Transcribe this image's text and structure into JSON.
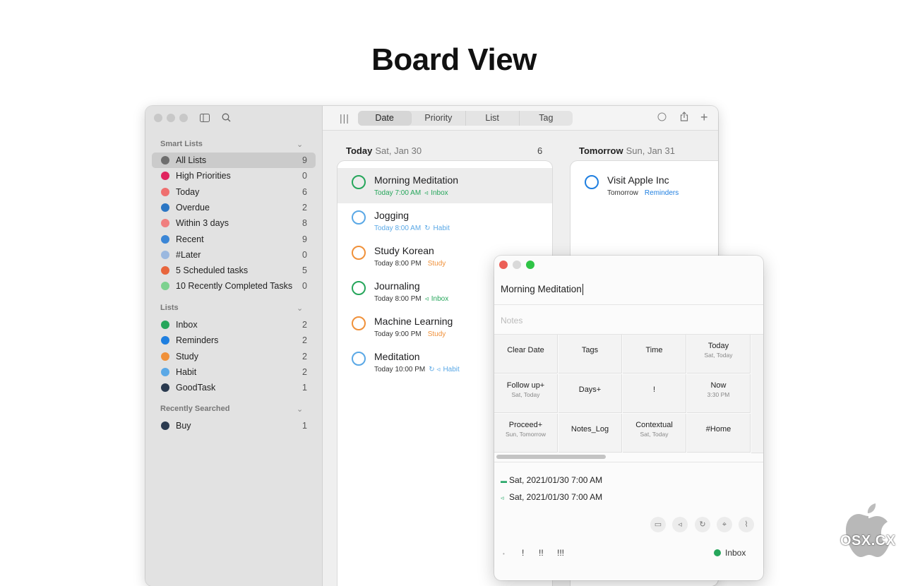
{
  "hero_title": "Board View",
  "sidebar": {
    "smart_header": "Smart Lists",
    "smart": [
      {
        "label": "All Lists",
        "count": "9",
        "icon": "checkmark-circle-icon",
        "color": "#6e6e6e",
        "selected": true
      },
      {
        "label": "High Priorities",
        "count": "0",
        "icon": "exclamation-icon",
        "color": "#e0245e"
      },
      {
        "label": "Today",
        "count": "6",
        "icon": "star-icon",
        "color": "#ef6f6f"
      },
      {
        "label": "Overdue",
        "count": "2",
        "icon": "overdue-icon",
        "color": "#2b76c4"
      },
      {
        "label": "Within 3 days",
        "count": "8",
        "icon": "clock-icon",
        "color": "#f07f7f"
      },
      {
        "label": "Recent",
        "count": "9",
        "icon": "plus-icon",
        "color": "#3b86d6"
      },
      {
        "label": "#Later",
        "count": "0",
        "icon": "hash-icon",
        "color": "#9bb8df"
      },
      {
        "label": "5 Scheduled tasks",
        "count": "5",
        "icon": "star-icon",
        "color": "#e8663d"
      },
      {
        "label": "10 Recently Completed Tasks",
        "count": "0",
        "icon": "check-icon",
        "color": "#7dd18f"
      }
    ],
    "lists_header": "Lists",
    "lists": [
      {
        "label": "Inbox",
        "count": "2",
        "icon": "inbox-icon",
        "color": "#26a65b"
      },
      {
        "label": "Reminders",
        "count": "2",
        "icon": "dot-icon",
        "color": "#1f7fe0"
      },
      {
        "label": "Study",
        "count": "2",
        "icon": "book-icon",
        "color": "#f0913a"
      },
      {
        "label": "Habit",
        "count": "2",
        "icon": "heart-icon",
        "color": "#5aa8e6"
      },
      {
        "label": "GoodTask",
        "count": "1",
        "icon": "check-icon",
        "color": "#2a3a4f"
      }
    ],
    "searched_header": "Recently Searched",
    "searched": [
      {
        "label": "Buy",
        "count": "1",
        "icon": "search-icon",
        "color": "#2a3a4f"
      }
    ]
  },
  "toolbar": {
    "tabs": [
      "Date",
      "Priority",
      "List",
      "Tag"
    ],
    "active": "Date"
  },
  "columns": {
    "today": {
      "title": "Today",
      "date": "Sat, Jan 30",
      "count": "6",
      "tasks": [
        {
          "title": "Morning Meditation",
          "time": "Today 7:00 AM",
          "list": "Inbox",
          "ring": "#26a65b",
          "time_color": "#26a65b",
          "list_color": "#26a65b",
          "list_icon": "◃"
        },
        {
          "title": "Jogging",
          "time": "Today 8:00 AM",
          "list": "Habit",
          "ring": "#5aa8e6",
          "time_color": "#5aa8e6",
          "list_color": "#5aa8e6",
          "list_icon": "↻"
        },
        {
          "title": "Study Korean",
          "time": "Today 8:00 PM",
          "list": "Study",
          "ring": "#f0913a",
          "time_color": "#333",
          "list_color": "#f0913a",
          "list_icon": ""
        },
        {
          "title": "Journaling",
          "time": "Today 8:00 PM",
          "list": "Inbox",
          "ring": "#26a65b",
          "time_color": "#333",
          "list_color": "#26a65b",
          "list_icon": "◃"
        },
        {
          "title": "Machine Learning",
          "time": "Today 9:00 PM",
          "list": "Study",
          "ring": "#f0913a",
          "time_color": "#333",
          "list_color": "#f0913a",
          "list_icon": ""
        },
        {
          "title": "Meditation",
          "time": "Today 10:00 PM",
          "list": "Habit",
          "ring": "#5aa8e6",
          "time_color": "#333",
          "list_color": "#5aa8e6",
          "list_icon": "↻ ◃"
        }
      ]
    },
    "tomorrow": {
      "title": "Tomorrow",
      "date": "Sun, Jan 31",
      "tasks": [
        {
          "title": "Visit Apple Inc",
          "time": "Tomorrow",
          "list": "Reminders",
          "ring": "#1f7fe0",
          "time_color": "#333",
          "list_color": "#1f7fe0",
          "list_icon": ""
        }
      ]
    }
  },
  "popup": {
    "title": "Morning Meditation",
    "notes_placeholder": "Notes",
    "grid": [
      {
        "main": "Clear Date",
        "sub": ""
      },
      {
        "main": "Tags",
        "sub": ""
      },
      {
        "main": "Time",
        "sub": ""
      },
      {
        "main": "Today",
        "sub": "Sat, Today"
      },
      {
        "main": "Follow up+",
        "sub": "Sat, Today"
      },
      {
        "main": "Days+",
        "sub": ""
      },
      {
        "main": "!",
        "sub": ""
      },
      {
        "main": "Now",
        "sub": "3:30 PM"
      },
      {
        "main": "Proceed+",
        "sub": "Sun, Tomorrow"
      },
      {
        "main": "Notes_Log",
        "sub": ""
      },
      {
        "main": "Contextual",
        "sub": "Sat, Today"
      },
      {
        "main": "#Home",
        "sub": ""
      }
    ],
    "due": "Sat, 2021/01/30 7:00 AM",
    "alarm": "Sat, 2021/01/30 7:00 AM",
    "priority": [
      "!",
      "!!",
      "!!!"
    ],
    "list": "Inbox",
    "list_color": "#26a65b"
  },
  "watermark": "OSX.CX"
}
